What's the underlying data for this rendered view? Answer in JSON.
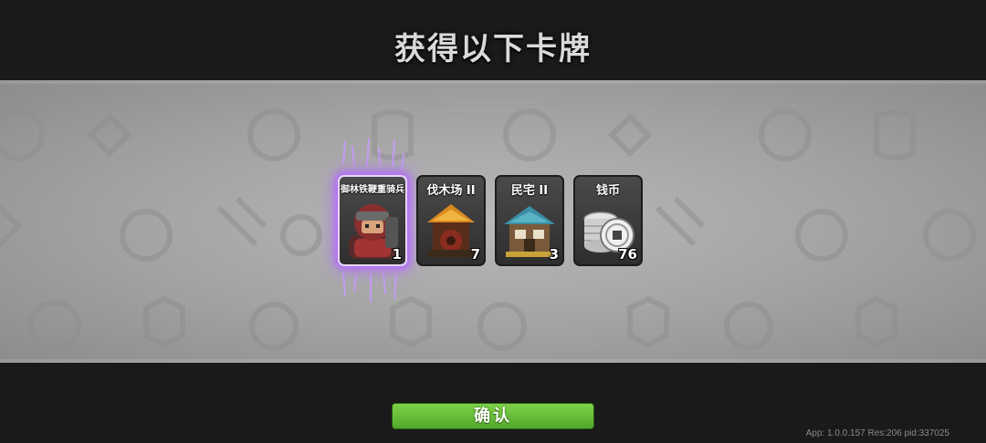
{
  "title": "获得以下卡牌",
  "cards": [
    {
      "name": "御林铁鞭重骑兵",
      "count": "1",
      "icon": "heavy-cavalry-soldier-icon",
      "highlighted": true
    },
    {
      "name": "伐木场 II",
      "count": "7",
      "icon": "lumber-mill-icon",
      "highlighted": false
    },
    {
      "name": "民宅 II",
      "count": "3",
      "icon": "house-icon",
      "highlighted": false
    },
    {
      "name": "钱币",
      "count": "76",
      "icon": "coin-stack-icon",
      "highlighted": false
    }
  ],
  "confirm_label": "确认",
  "version_text": "App: 1.0.0.157 Res:206 pid:337025",
  "colors": {
    "confirm": "#6abf3c",
    "highlight_glow": "#b36bff",
    "band": "#a8a8a8"
  }
}
